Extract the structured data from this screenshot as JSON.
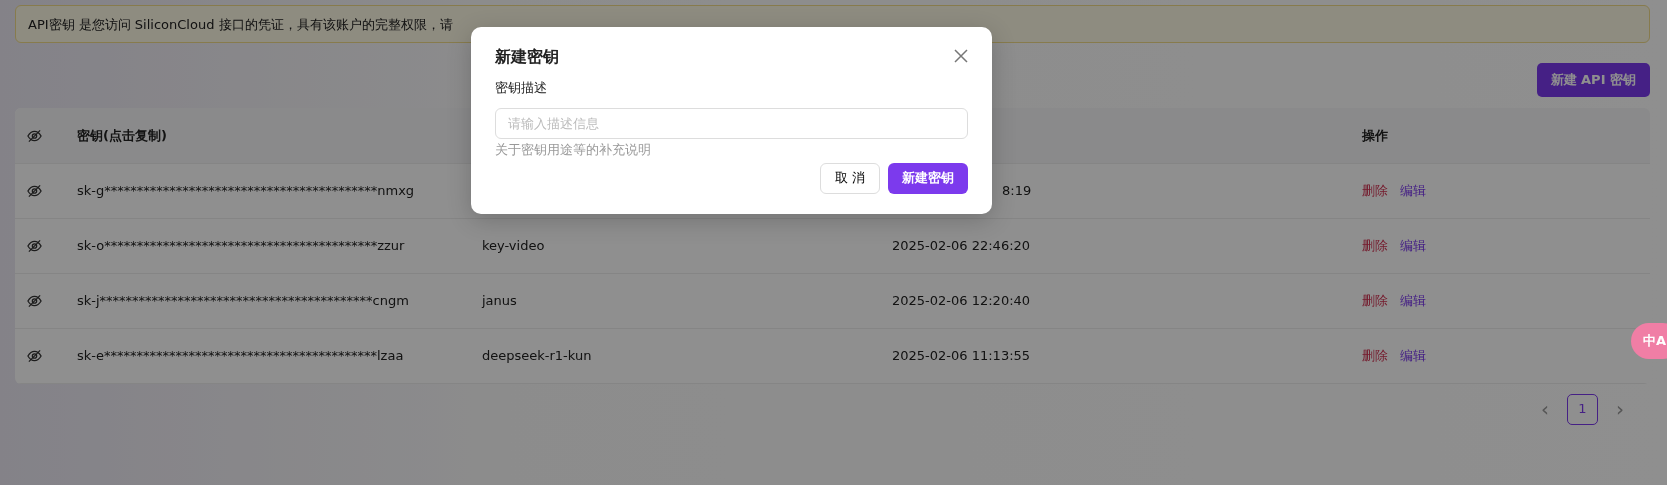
{
  "notice": "API密钥 是您访问 SiliconCloud 接口的凭证，具有该账户的完整权限，请",
  "create_button": "新建 API 密钥",
  "table": {
    "columns": [
      {
        "kind": "icon"
      },
      {
        "kind": "text",
        "label": "密钥(点击复制)"
      },
      {
        "kind": "hidden"
      },
      {
        "kind": "hidden"
      },
      {
        "kind": "text",
        "label": "操作"
      }
    ],
    "rows": [
      {
        "key": "sk-g******************************************nmxg",
        "created": "8:19",
        "partly_hidden": true,
        "actions": [
          "删除",
          "编辑"
        ]
      },
      {
        "key": "sk-o******************************************zzur",
        "description": "key-video",
        "created": "2025-02-06 22:46:20",
        "partly_hidden": false,
        "actions": [
          "删除",
          "编辑"
        ]
      },
      {
        "key": "sk-j******************************************cngm",
        "description": "janus",
        "created": "2025-02-06 12:20:40",
        "partly_hidden": false,
        "actions": [
          "删除",
          "编辑"
        ]
      },
      {
        "key": "sk-e******************************************lzaa",
        "description": "deepseek-r1-kun",
        "created": "2025-02-06 11:13:55",
        "partly_hidden": false,
        "actions": [
          "删除",
          "编辑"
        ]
      }
    ]
  },
  "pagination": {
    "prev": "‹",
    "next": "›",
    "pages": [
      {
        "label": "1",
        "selected": true
      }
    ]
  },
  "translate_widget": "中A",
  "modal": {
    "title": "新建密钥",
    "field_label": "密钥描述",
    "placeholder": "请输入描述信息",
    "help": "关于密钥用途等的补充说明",
    "buttons": [
      {
        "label": "取 消",
        "kind": "secondary"
      },
      {
        "label": "新建密钥",
        "kind": "primary"
      }
    ]
  }
}
